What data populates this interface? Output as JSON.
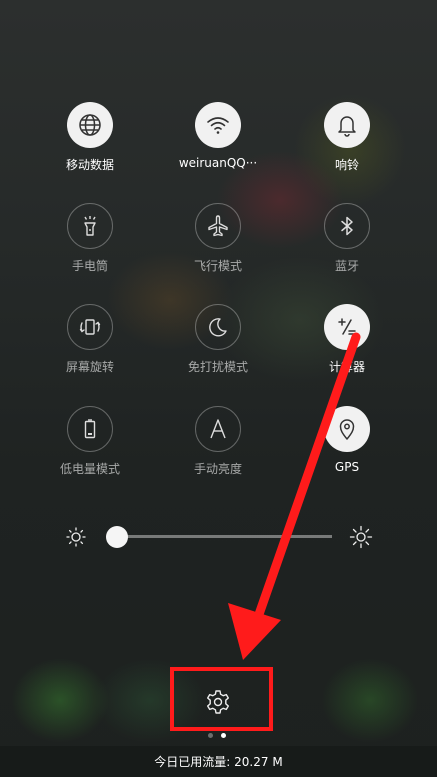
{
  "tiles": [
    {
      "label": "移动数据",
      "icon": "globe-icon",
      "state": "on"
    },
    {
      "label": "weiruanQQ···",
      "icon": "wifi-icon",
      "state": "on"
    },
    {
      "label": "响铃",
      "icon": "bell-icon",
      "state": "on"
    },
    {
      "label": "手电筒",
      "icon": "flashlight-icon",
      "state": "off"
    },
    {
      "label": "飞行模式",
      "icon": "airplane-icon",
      "state": "off"
    },
    {
      "label": "蓝牙",
      "icon": "bluetooth-icon",
      "state": "off"
    },
    {
      "label": "屏幕旋转",
      "icon": "rotate-icon",
      "state": "off"
    },
    {
      "label": "免打扰模式",
      "icon": "moon-icon",
      "state": "off"
    },
    {
      "label": "计算器",
      "icon": "calculator-icon",
      "state": "on"
    },
    {
      "label": "低电量模式",
      "icon": "battery-icon",
      "state": "off"
    },
    {
      "label": "手动亮度",
      "icon": "auto-brightness-icon",
      "state": "off"
    },
    {
      "label": "GPS",
      "icon": "location-pin-icon",
      "state": "on"
    }
  ],
  "brightness": {
    "level": 0.03
  },
  "pager": {
    "pages": 2,
    "active": 2
  },
  "footer": {
    "data_usage": "今日已用流量: 20.27 M"
  },
  "colors": {
    "highlight": "#ff1b1b",
    "tile_on": "#f1f1f1"
  }
}
